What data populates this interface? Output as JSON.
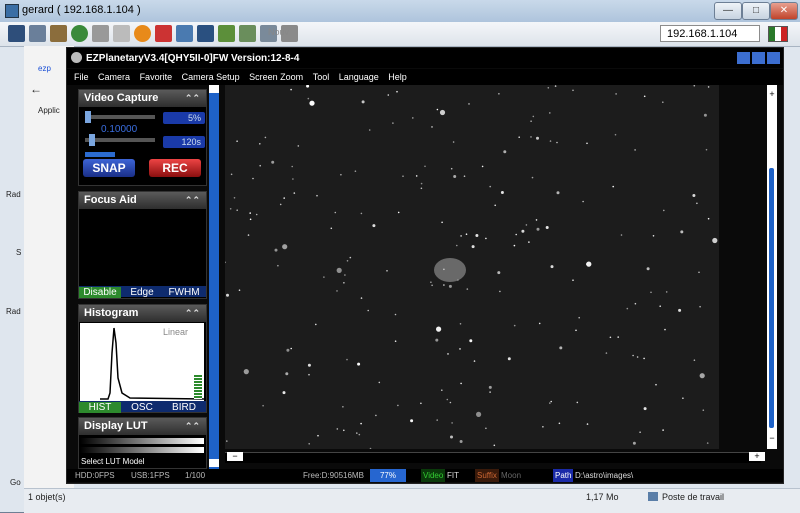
{
  "outer_window": {
    "title": "gerard ( 192.168.1.104 )",
    "ip": "192.168.1.104",
    "buttons": {
      "minimize": "—",
      "maximize": "□",
      "close": "✕"
    }
  },
  "browser_bg": {
    "tab": "ezp",
    "apps": "Applic",
    "side_labels": [
      "Rad",
      "S",
      "Rad",
      "Go"
    ],
    "cloud_label": "Nouv"
  },
  "ez": {
    "title": "EZPlanetaryV3.4[QHY5II-0]FW Version:12-8-4",
    "menu": [
      "File",
      "Camera",
      "Favorite",
      "Camera Setup",
      "Screen Zoom",
      "Tool",
      "Language",
      "Help"
    ],
    "video_capture": {
      "header": "Video Capture",
      "gain": "5%",
      "exposure_ms": "0.10000",
      "fps_label": "120s",
      "snap": "SNAP",
      "rec": "REC"
    },
    "focus_aid": {
      "header": "Focus Aid",
      "tabs": [
        "Disable",
        "Edge",
        "FWHM"
      ]
    },
    "histogram": {
      "header": "Histogram",
      "mode": "Linear",
      "tabs": [
        "HIST",
        "OSC",
        "BIRD"
      ]
    },
    "display_lut": {
      "header": "Display LUT",
      "select": "Select LUT Model"
    },
    "zoom": {
      "minus": "−",
      "plus": "+"
    },
    "status": {
      "hdd": "HDD:0FPS",
      "usb": "USB:1FPS",
      "count": "1/100",
      "free": "Free:D:90516MB",
      "pct": "77%",
      "video_label": "Video",
      "video_format": "FIT",
      "suffix_label": "Suffix",
      "suffix_value": "Moon",
      "path_label": "Path",
      "path_value": "D:\\astro\\images\\"
    }
  },
  "taskbar": {
    "objects": "1 objet(s)",
    "size": "1,17 Mo",
    "location": "Poste de travail"
  }
}
